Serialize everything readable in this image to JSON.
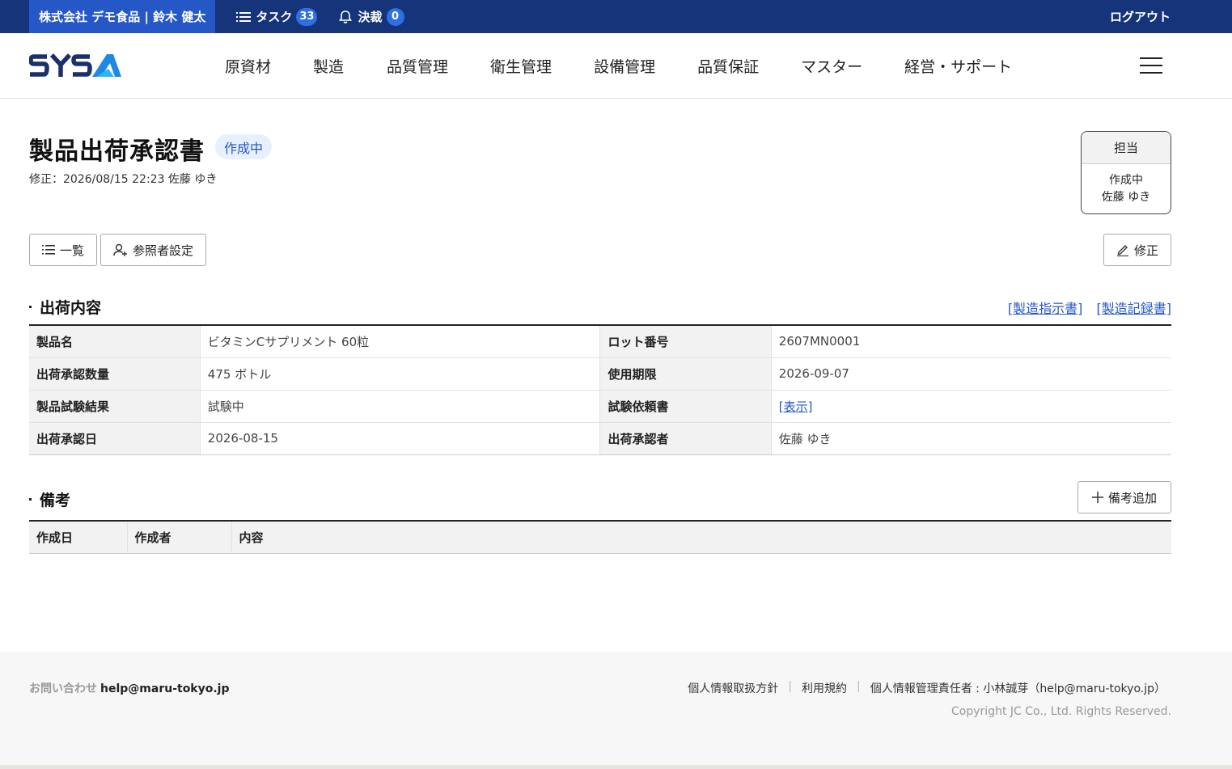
{
  "topbar": {
    "company": "株式会社 デモ食品 | 鈴木 健太",
    "tasks_label": "タスク",
    "tasks_count": "33",
    "approvals_label": "決裁",
    "approvals_count": "0",
    "logout": "ログアウト"
  },
  "nav": {
    "items": [
      "原資材",
      "製造",
      "品質管理",
      "衛生管理",
      "設備管理",
      "品質保証",
      "マスター",
      "経営・サポート"
    ]
  },
  "page": {
    "title": "製品出荷承認書",
    "status": "作成中",
    "modified": "修正：2026/08/15 22:23  佐藤 ゆき"
  },
  "assignee": {
    "header": "担当",
    "status": "作成中",
    "name": "佐藤 ゆき"
  },
  "buttons": {
    "list": "一覧",
    "viewers": "参照者設定",
    "edit": "修正",
    "add_remark": "備考追加"
  },
  "shipping": {
    "title": "出荷内容",
    "link_instruction": "[製造指示書]",
    "link_record": "[製造記録書]",
    "rows": [
      {
        "l1": "製品名",
        "v1": "ビタミンCサプリメント 60粒",
        "l2": "ロット番号",
        "v2": "2607MN0001"
      },
      {
        "l1": "出荷承認数量",
        "v1": "475 ボトル",
        "l2": "使用期限",
        "v2": "2026-09-07"
      },
      {
        "l1": "製品試験結果",
        "v1": "試験中",
        "l2": "試験依頼書",
        "v2": "[表示]"
      },
      {
        "l1": "出荷承認日",
        "v1": "2026-08-15",
        "l2": "出荷承認者",
        "v2": "佐藤 ゆき"
      }
    ]
  },
  "remarks": {
    "title": "備考",
    "columns": [
      "作成日",
      "作成者",
      "内容"
    ]
  },
  "footer": {
    "contact_label": "お問い合わせ",
    "contact_email": "help@maru-tokyo.jp",
    "privacy": "個人情報取扱方針",
    "terms": "利用規約",
    "manager": "個人情報管理責任者 : 小林誠芽（help@maru-tokyo.jp）",
    "copyright": "Copyright JC Co., Ltd. Rights Reserved."
  },
  "colors": {
    "topbar": "#15347a",
    "company_bg": "#2557c6",
    "badge": "#2f6fe6",
    "link": "#2557c6"
  }
}
